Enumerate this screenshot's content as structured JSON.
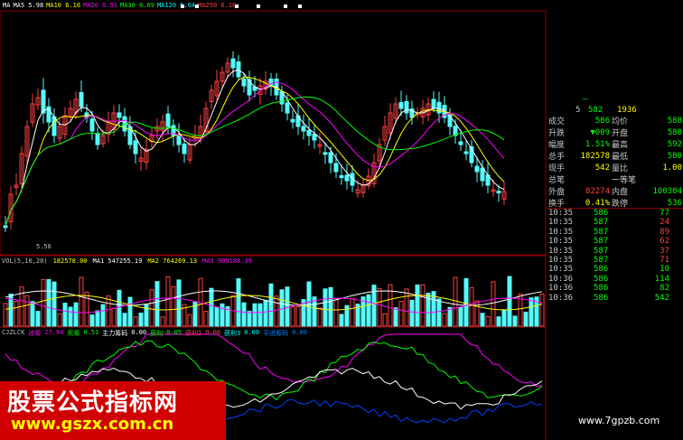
{
  "ma_bar": {
    "items": [
      {
        "label": "MA",
        "value": "",
        "color": "#ffffff"
      },
      {
        "label": "MA5",
        "value": "5.98",
        "color": "#ffffff"
      },
      {
        "label": "MA10",
        "value": "6.16",
        "color": "#ffff00"
      },
      {
        "label": "MA20",
        "value": "6.51",
        "color": "#ff00ff"
      },
      {
        "label": "MA30",
        "value": "6.69",
        "color": "#00ff00"
      },
      {
        "label": "MA120",
        "value": "6.64",
        "color": "#00ffff"
      },
      {
        "label": "MA250",
        "value": "6.16",
        "color": "#ff4040"
      }
    ]
  },
  "low_price_label": "5.56",
  "vol_bar": {
    "title": "VOL(5,10,20)",
    "v": "182578.00",
    "ma1": "MA1 547255.19",
    "ma2": "MA2 764269.13",
    "ma3": "MA3 909188.39"
  },
  "ind_bar": {
    "name": "CJZLCK",
    "a_label": "进筹",
    "a_val": "27.94",
    "b_label": "死筹",
    "b_val": "0.51",
    "c_label": "主力筹码",
    "c_val": "0.00",
    "d_label": "获利",
    "d_val": "0.05",
    "e_label": "获利2",
    "e_val": "0.00",
    "f_label": "获利3",
    "f_val": "0.00",
    "g_label": "平进筹码",
    "g_val": "0.00"
  },
  "quote": {
    "partial_top": [
      {
        "key": "",
        "val": "",
        "v2": "",
        "v2color": "#00ff00"
      },
      {
        "key": "5",
        "val": "582",
        "val2": "1936"
      }
    ],
    "rows": [
      {
        "k1": "成交",
        "v1": "586",
        "v1c": "#00ff00",
        "k2": "均价",
        "v2": "588",
        "v2c": "#00ff00"
      },
      {
        "k1": "升跌",
        "v1": "▼009",
        "v1c": "#00ff00",
        "k2": "开盘",
        "v2": "588",
        "v2c": "#00ff00"
      },
      {
        "k1": "幅度",
        "v1": "1.51%",
        "v1c": "#00ff00",
        "k2": "最高",
        "v2": "592",
        "v2c": "#00ff00"
      },
      {
        "k1": "总手",
        "v1": "182578",
        "v1c": "#ffff00",
        "k2": "最低",
        "v2": "580",
        "v2c": "#00ff00"
      },
      {
        "k1": "现手",
        "v1": "542",
        "v1c": "#ffff00",
        "k2": "量比",
        "v2": "1.00",
        "v2c": "#ffff00"
      },
      {
        "k1": "总笔",
        "v1": "",
        "v1c": "#ffff00",
        "k2": "一等笔",
        "v2": "",
        "v2c": "#ffff00"
      },
      {
        "k1": "外盘",
        "v1": "82274",
        "v1c": "#ff4040",
        "k2": "内盘",
        "v2": "100304",
        "v2c": "#00ff00"
      },
      {
        "k1": "换手",
        "v1": "0.41%",
        "v1c": "#ffff00",
        "k2": "跌停",
        "v2": "536",
        "v2c": "#00ff00"
      }
    ],
    "ticks": [
      {
        "t": "10:35",
        "p": "586",
        "pc": "#00ff00",
        "v": "77",
        "vc": "#00ff00"
      },
      {
        "t": "10:35",
        "p": "587",
        "pc": "#00ff00",
        "v": "24",
        "vc": "#ff4040"
      },
      {
        "t": "10:35",
        "p": "587",
        "pc": "#00ff00",
        "v": "89",
        "vc": "#ff4040"
      },
      {
        "t": "10:35",
        "p": "587",
        "pc": "#00ff00",
        "v": "62",
        "vc": "#ff4040"
      },
      {
        "t": "10:35",
        "p": "587",
        "pc": "#00ff00",
        "v": "37",
        "vc": "#ff4040"
      },
      {
        "t": "10:35",
        "p": "587",
        "pc": "#00ff00",
        "v": "71",
        "vc": "#ff4040"
      },
      {
        "t": "10:35",
        "p": "586",
        "pc": "#00ff00",
        "v": "10",
        "vc": "#00ff00"
      },
      {
        "t": "10:36",
        "p": "586",
        "pc": "#00ff00",
        "v": "114",
        "vc": "#00ff00"
      },
      {
        "t": "10:36",
        "p": "586",
        "pc": "#00ff00",
        "v": "82",
        "vc": "#00ff00"
      },
      {
        "t": "10:36",
        "p": "586",
        "pc": "#00ff00",
        "v": "542",
        "vc": "#00ff00"
      }
    ]
  },
  "watermark_main": "股票公式指标网",
  "watermark_url": "www.gszx.com.cn",
  "watermark_right": "www.7gpzb.com"
}
